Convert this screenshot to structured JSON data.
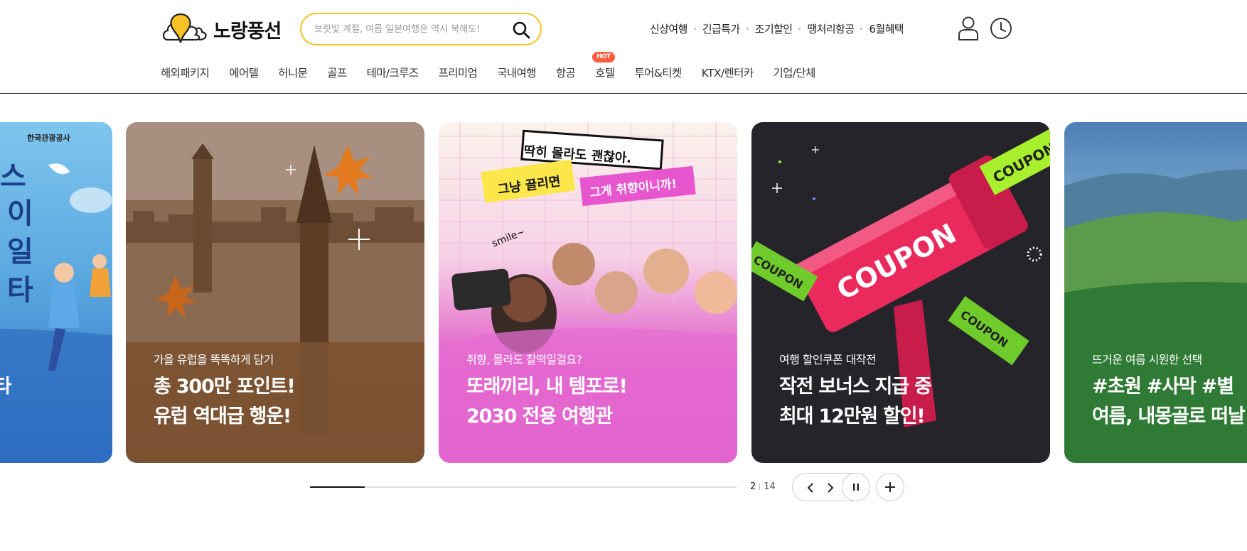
{
  "brand": {
    "name": "노랑풍선",
    "logo_icon": "yellow-balloon-cloud-icon",
    "accent_color": "#f7c325"
  },
  "search": {
    "placeholder": "보랏빛 계절, 여름 일본여행은 역시 북해도!",
    "value": "",
    "icon": "search-icon"
  },
  "quick_links": [
    "신상여행",
    "긴급특가",
    "조기할인",
    "땡처리항공",
    "6월혜택"
  ],
  "header_icons": {
    "user": "user-icon",
    "recent": "clock-icon"
  },
  "gnb": {
    "items": [
      {
        "label": "해외패키지"
      },
      {
        "label": "에어텔"
      },
      {
        "label": "허니문"
      },
      {
        "label": "골프"
      },
      {
        "label": "테마/크루즈"
      },
      {
        "label": "프리미엄"
      },
      {
        "label": "국내여행"
      },
      {
        "label": "항공"
      },
      {
        "label": "호텔",
        "badge": "HOT"
      },
      {
        "label": "투어&티켓"
      },
      {
        "label": "KTX/렌터카"
      },
      {
        "label": "기업/단체"
      }
    ],
    "badge_color": "#ff5a3c"
  },
  "banners": [
    {
      "id": "korea-tourism",
      "brand_text": "한국관광공사",
      "subtitle": "",
      "title_line1": "",
      "title_line2": "스타",
      "color": "#3b82d0"
    },
    {
      "id": "europe",
      "subtitle": "가을 유럽을 똑똑하게 담기",
      "title_line1": "총 300만 포인트!",
      "title_line2": "유럽 역대급 행운!",
      "color": "#7a5233"
    },
    {
      "id": "2030",
      "subtitle": "취향, 몰라도 찰떡일걸요?",
      "title_line1": "또래끼리, 내 템포로!",
      "title_line2": "2030 전용 여행관",
      "stickers": [
        "딱히 몰라도 괜찮아.",
        "그냥 끌리면",
        "그게 취향이니까!",
        "smile~"
      ],
      "color": "#d945c5"
    },
    {
      "id": "coupon",
      "subtitle": "여행 할인쿠폰 대작전",
      "title_line1": "작전 보너스 지급 중",
      "title_line2": "최대 12만원 할인!",
      "coupon_text": "COUPON",
      "color": "#24242a"
    },
    {
      "id": "mongolia",
      "subtitle": "뜨거운 여름 시원한 선택",
      "title_line1": "#초원 #사막 #별",
      "title_line2": "여름, 내몽골로 떠날",
      "color": "#2f7a34"
    }
  ],
  "pagination": {
    "current": "2",
    "total": "14",
    "progress": 0.1286
  },
  "controls": {
    "prev": "chevron-left-icon",
    "next": "chevron-right-icon",
    "pause": "pause-icon",
    "more": "plus-icon"
  }
}
